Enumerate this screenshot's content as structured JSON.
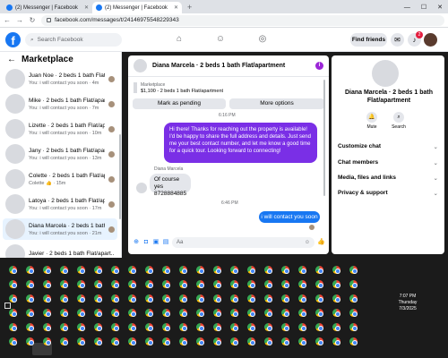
{
  "browser": {
    "tabs": [
      {
        "title": "(2) Messenger | Facebook",
        "active": false
      },
      {
        "title": "(2) Messenger | Facebook",
        "active": true
      }
    ],
    "url": "facebook.com/messages/t/24146975548229343"
  },
  "header": {
    "search_placeholder": "Search Facebook",
    "find_friends": "Find friends",
    "notification_count": "2"
  },
  "sidebar": {
    "title": "Marketplace",
    "conversations": [
      {
        "name": "Juan Noe · 2 beds 1 bath Flat/apart...",
        "snippet": "You: i will contact you soon · 4m"
      },
      {
        "name": "Mike · 2 beds 1 bath Flat/apartment",
        "snippet": "You: i will contact you soon · 7m"
      },
      {
        "name": "Lizette · 2 beds 1 bath Flat/apart...",
        "snippet": "You: i will contact you soon · 10m"
      },
      {
        "name": "Jany · 2 beds 1 bath Flat/apartm...",
        "snippet": "You: i will contact you soon · 13m"
      },
      {
        "name": "Colette · 2 beds 1 bath Flat/apar...",
        "snippet": "Colette 👍 · 15m"
      },
      {
        "name": "Latoya · 2 beds 1 bath Flat/apart...",
        "snippet": "You: i will contact you soon · 17m"
      },
      {
        "name": "Diana Marcela · 2 beds 1 bath Fl...",
        "snippet": "You: i will contact you soon · 21m",
        "selected": true
      },
      {
        "name": "Javier · 2 beds 1 bath Flat/apart...",
        "snippet": ""
      }
    ]
  },
  "chat": {
    "title": "Diana Marcela · 2 beds 1 bath Flat/apartment",
    "listing_label": "Marketplace",
    "listing_value": "$1,100 - 2 beds 1 bath Flat/apartment",
    "mark_pending": "Mark as pending",
    "more_options": "More options",
    "time1": "6:16 PM",
    "msg_out_1": "Hi there! Thanks for reaching out the property is available! I'd be happy to share the full address and details. Just send me your best contact number, and let me know a good time for a quick tour. Looking forward to connecting!",
    "sender_name": "Diana Marcela",
    "msg_in_1_line1": "Of course yes",
    "msg_in_1_line2": "8728884885",
    "time2": "6:46 PM",
    "msg_out_2": "i will contact you soon",
    "composer_placeholder": "Aa"
  },
  "right_panel": {
    "title": "Diana Marcela · 2 beds 1 bath Flat/apartment",
    "mute": "Mute",
    "search": "Search",
    "items": [
      "Customize chat",
      "Chat members",
      "Media, files and links",
      "Privacy & support"
    ]
  },
  "taskbar": {
    "time": "7:07 PM",
    "day": "Thursday",
    "date": "7/3/2025"
  },
  "colors": {
    "fb_blue": "#1877f2",
    "outgoing_purple": "#7a2fe6",
    "selected_row": "#e7f3ff"
  }
}
